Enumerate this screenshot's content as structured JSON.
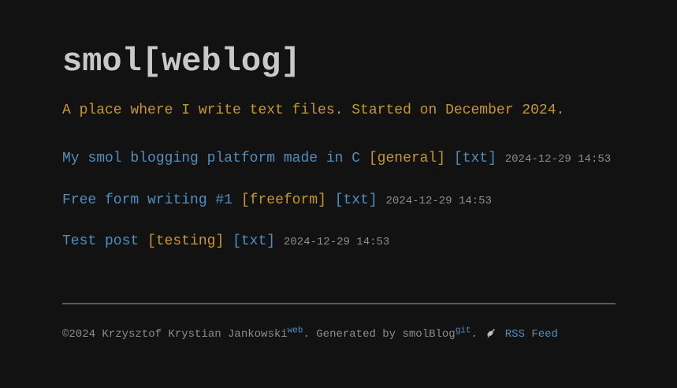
{
  "header": {
    "title": "smol[weblog]",
    "tagline": "A place where I write text files. Started on December 2024."
  },
  "posts": [
    {
      "title": "My smol blogging platform made in C",
      "tag": "[general]",
      "format": "[txt]",
      "date": "2024-12-29 14:53"
    },
    {
      "title": "Free form writing #1",
      "tag": "[freeform]",
      "format": "[txt]",
      "date": "2024-12-29 14:53"
    },
    {
      "title": "Test post",
      "tag": "[testing]",
      "format": "[txt]",
      "date": "2024-12-29 14:53"
    }
  ],
  "footer": {
    "copyright": "©2024 Krzysztof Krystian Jankowski",
    "web_label": "web",
    "generated_text": ". Generated by smolBlog",
    "git_label": "git",
    "separator": ".",
    "rss_label": "RSS Feed",
    "rss_icon": "satellite-antenna-icon"
  },
  "colors": {
    "background": "#121212",
    "title": "#c8c8c8",
    "accent_gold": "#c8962e",
    "link_blue": "#4f8fbf",
    "muted": "#8c8c8c"
  }
}
